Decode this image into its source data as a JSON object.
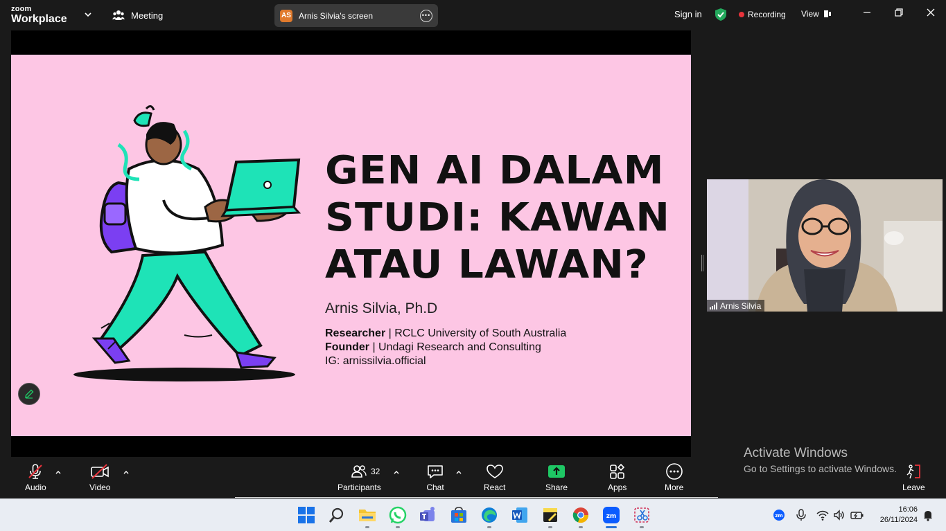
{
  "app": {
    "brand_top": "zoom",
    "brand_bottom": "Workplace",
    "meeting_label": "Meeting",
    "share_pill": {
      "initials": "AS",
      "label": "Arnis Silvia's screen"
    },
    "signin_label": "Sign in",
    "recording_label": "Recording",
    "view_label": "View",
    "colors": {
      "accent_green": "#23a85c",
      "recording_red": "#e8333b",
      "share_green": "#1ec764",
      "slide_pink": "#fdc6e4",
      "slide_teal": "#1ee3b7",
      "slide_purple": "#7b3ff2"
    }
  },
  "slide": {
    "title_lines": [
      "GEN AI DALAM",
      "STUDI: KAWAN",
      "ATAU LAWAN?"
    ],
    "presenter": "Arnis Silvia, Ph.D",
    "role1_bold": "Researcher",
    "role1_rest": " | RCLC University of South Australia",
    "role2_bold": "Founder",
    "role2_rest": " | Undagi Research and Consulting",
    "ig": "IG: arnissilvia.official"
  },
  "video": {
    "participant_name": "Arnis Silvia"
  },
  "toolbar": {
    "audio_label": "Audio",
    "video_label": "Video",
    "participants_label": "Participants",
    "participants_count": "32",
    "chat_label": "Chat",
    "react_label": "React",
    "share_label": "Share",
    "apps_label": "Apps",
    "more_label": "More",
    "leave_label": "Leave"
  },
  "watermark": {
    "line1": "Activate Windows",
    "line2": "Go to Settings to activate Windows."
  },
  "taskbar": {
    "icons": [
      "windows-start-icon",
      "search-icon",
      "file-explorer-icon",
      "whatsapp-icon",
      "teams-icon",
      "store-icon",
      "edge-icon",
      "word-icon",
      "sticky-notes-icon",
      "chrome-icon",
      "zoom-icon",
      "snipping-tool-icon"
    ],
    "time": "16:06",
    "date": "26/11/2024"
  }
}
